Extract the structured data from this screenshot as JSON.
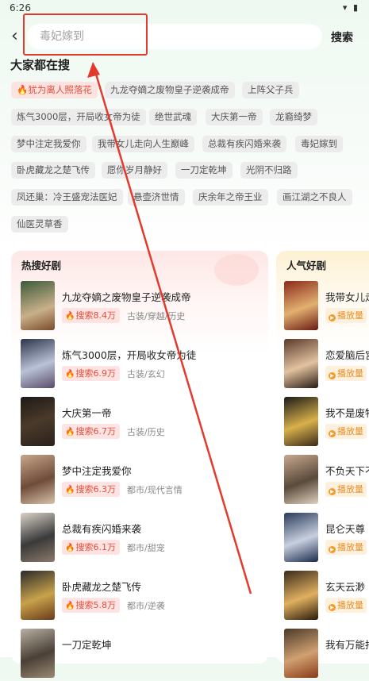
{
  "status_bar": {
    "time": "6:26",
    "icons": "▾ ▮"
  },
  "search": {
    "placeholder": "毒妃嫁到",
    "button_label": "搜索",
    "back_icon": "‹"
  },
  "popular": {
    "title": "大家都在搜",
    "chips": [
      "犹为离人照落花",
      "九龙夺嫡之废物皇子逆袭成帝",
      "上阵父子兵",
      "炼气3000层，开局收女帝为徒",
      "绝世武魂",
      "大庆第一帝",
      "龙裔绮梦",
      "梦中注定我爱你",
      "我带女儿走向人生巅峰",
      "总裁有疾闪婚来袭",
      "毒妃嫁到",
      "卧虎藏龙之楚飞传",
      "愿你岁月静好",
      "一刀定乾坤",
      "光阴不归路",
      "凤还巢：冷王盛宠法医妃",
      "悬壶济世情",
      "庆余年之帝王业",
      "画江湖之不良人",
      "仙医灵草香"
    ]
  },
  "hot_dramas": {
    "title": "热搜好剧",
    "items": [
      {
        "title": "九龙夺嫡之废物皇子逆袭成帝",
        "badge": "搜索8.4万",
        "genre": "古装/穿越/历史"
      },
      {
        "title": "炼气3000层，开局收女帝为徒",
        "badge": "搜索6.9万",
        "genre": "古装/玄幻"
      },
      {
        "title": "大庆第一帝",
        "badge": "搜索6.7万",
        "genre": "古装/历史"
      },
      {
        "title": "梦中注定我爱你",
        "badge": "搜索6.3万",
        "genre": "都市/现代言情"
      },
      {
        "title": "总裁有疾闪婚来袭",
        "badge": "搜索6.1万",
        "genre": "都市/甜宠"
      },
      {
        "title": "卧虎藏龙之楚飞传",
        "badge": "搜索5.8万",
        "genre": "都市/逆袭"
      },
      {
        "title": "一刀定乾坤",
        "badge": "",
        "genre": ""
      }
    ]
  },
  "popular_dramas": {
    "title": "人气好剧",
    "items": [
      {
        "title": "我带女儿走",
        "badge": "播放量"
      },
      {
        "title": "恋爱脑后宫",
        "badge": "播放量"
      },
      {
        "title": "我不是废物",
        "badge": "播放量"
      },
      {
        "title": "不负天下不",
        "badge": "播放量"
      },
      {
        "title": "昆仑天尊",
        "badge": "播放量"
      },
      {
        "title": "玄天云渺",
        "badge": "播放量"
      },
      {
        "title": "我有万能抖",
        "badge": ""
      }
    ]
  },
  "colors": {
    "accent": "#e23b2e",
    "hot_text": "#e24d3b",
    "play_orange": "#f29b2b"
  }
}
